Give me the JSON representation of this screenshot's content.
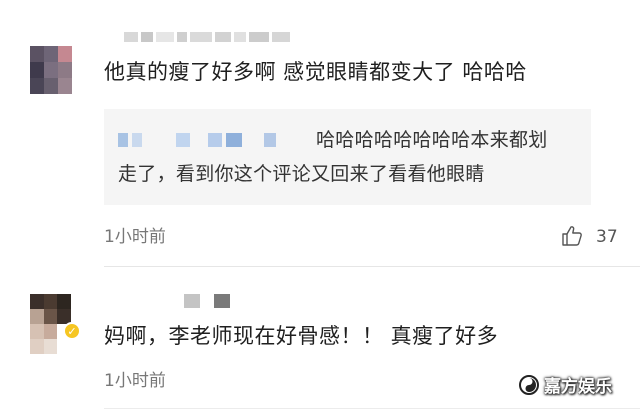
{
  "comments": [
    {
      "text": "他真的瘦了好多啊 感觉眼睛都变大了 哈哈哈",
      "reply": {
        "line1": "哈哈哈哈哈哈哈哈本来都划",
        "line2": "走了，看到你这个评论又回来了看看他眼睛"
      },
      "time": "1小时前",
      "likes": "37"
    },
    {
      "text": "妈啊，李老师现在好骨感！！ 真瘦了好多",
      "time": "1小时前",
      "badge_icon": "verified-v-icon"
    }
  ],
  "watermark": {
    "text": "嘉方娱乐",
    "icon": "swirl-logo-icon"
  },
  "colors": {
    "reply_background": "#f5f5f5",
    "time_text": "#777777",
    "badge": "#f6c623"
  }
}
